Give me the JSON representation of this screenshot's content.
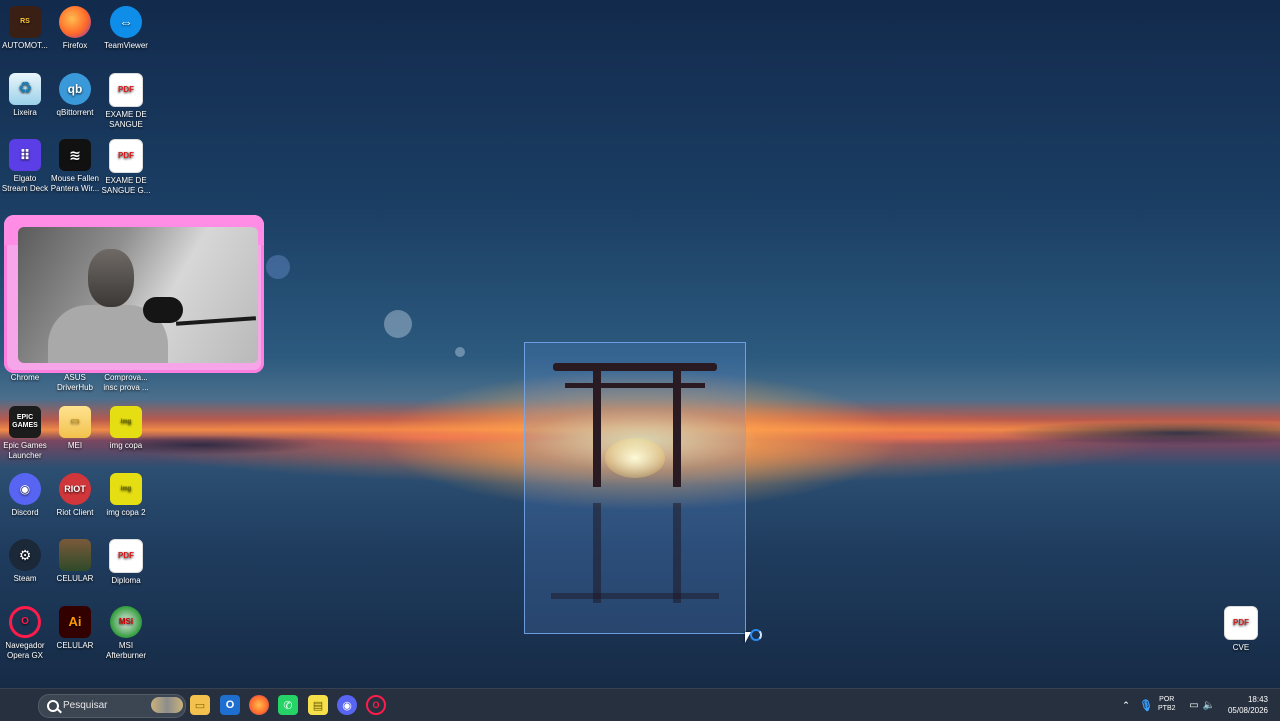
{
  "desktop_icons": [
    {
      "label": "AUTOMOT...",
      "glyph": "RS"
    },
    {
      "label": "Firefox",
      "glyph": ""
    },
    {
      "label": "TeamViewer",
      "glyph": "⇔"
    },
    {
      "label": "Lixeira",
      "glyph": "♻"
    },
    {
      "label": "qBittorrent",
      "glyph": "qb"
    },
    {
      "label": "EXAME DE SANGUE",
      "glyph": "PDF"
    },
    {
      "label": "Elgato Stream Deck",
      "glyph": "⠿"
    },
    {
      "label": "Mouse Fallen Pantera Wir...",
      "glyph": "≋"
    },
    {
      "label": "EXAME DE SANGUE G...",
      "glyph": "PDF"
    },
    {
      "label": "Chrome",
      "glyph": ""
    },
    {
      "label": "ASUS DriverHub",
      "glyph": ""
    },
    {
      "label": "Comprova... insc prova ...",
      "glyph": ""
    },
    {
      "label": "Epic Games Launcher",
      "glyph": "EPIC GAMES"
    },
    {
      "label": "MEI",
      "glyph": "▭"
    },
    {
      "label": "img copa",
      "glyph": "img"
    },
    {
      "label": "Discord",
      "glyph": "◉"
    },
    {
      "label": "Riot Client",
      "glyph": "RIOT"
    },
    {
      "label": "img copa 2",
      "glyph": "img"
    },
    {
      "label": "Steam",
      "glyph": "⚙"
    },
    {
      "label": "CELULAR",
      "glyph": ""
    },
    {
      "label": "Diploma",
      "glyph": "PDF"
    },
    {
      "label": "Navegador Opera GX",
      "glyph": "O"
    },
    {
      "label": "CELULAR",
      "glyph": "Ai"
    },
    {
      "label": "MSI Afterburner",
      "glyph": "MSI"
    },
    {
      "label": "CVE",
      "glyph": "PDF"
    }
  ],
  "taskbar": {
    "search_placeholder": "Pesquisar",
    "pinned": [
      "file-explorer",
      "outlook",
      "firefox",
      "whatsapp",
      "sticky-notes",
      "discord",
      "opera-gx"
    ],
    "tray": {
      "language_line1": "POR",
      "language_line2": "PTB2",
      "time": "18:43",
      "date": "05/08/2026"
    }
  },
  "colors": {
    "accent": "#3aa0ff",
    "webcam_frame": "#ff8de5",
    "selection": "#5a8cdc"
  }
}
